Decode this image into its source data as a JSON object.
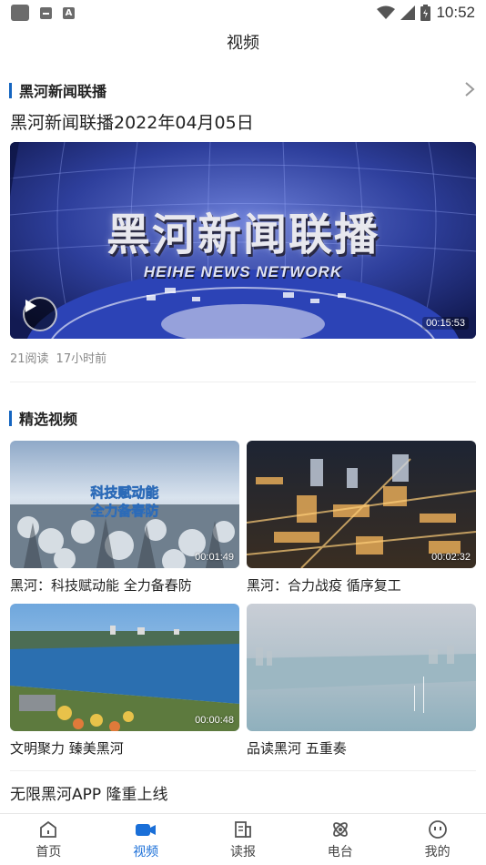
{
  "status_bar": {
    "time": "10:52",
    "icons": [
      "notification-square-icon",
      "mail-icon",
      "font-icon",
      "wifi-icon",
      "signal-icon",
      "battery-icon"
    ]
  },
  "header": {
    "title": "视频"
  },
  "news_section": {
    "title": "黑河新闻联播",
    "featured": {
      "title": "黑河新闻联播2022年04月05日",
      "thumbnail_title": "黑河新闻联播",
      "thumbnail_subtitle": "HEIHE NEWS NETWORK",
      "duration": "00:15:53",
      "reads": "21阅读",
      "time_ago": "17小时前"
    }
  },
  "featured_section": {
    "title": "精选视频",
    "videos": [
      {
        "caption": "黑河：科技赋动能 全力备春防",
        "duration": "00:01:49",
        "overlay": [
          "科技赋动能",
          "全力备春防"
        ]
      },
      {
        "caption": "黑河：合力战疫 循序复工",
        "duration": "00:02:32"
      },
      {
        "caption": "文明聚力 臻美黑河",
        "duration": "00:00:48"
      },
      {
        "caption": "品读黑河 五重奏",
        "duration": ""
      }
    ]
  },
  "promo": {
    "text": "无限黑河APP  隆重上线"
  },
  "tab_bar": {
    "tabs": [
      {
        "label": "首页",
        "icon": "home-icon",
        "active": false
      },
      {
        "label": "视频",
        "icon": "video-camera-icon",
        "active": true
      },
      {
        "label": "读报",
        "icon": "newspaper-icon",
        "active": false
      },
      {
        "label": "电台",
        "icon": "radio-icon",
        "active": false
      },
      {
        "label": "我的",
        "icon": "profile-icon",
        "active": false
      }
    ]
  },
  "colors": {
    "accent": "#1a6fd8",
    "section_bar": "#1565c0"
  }
}
